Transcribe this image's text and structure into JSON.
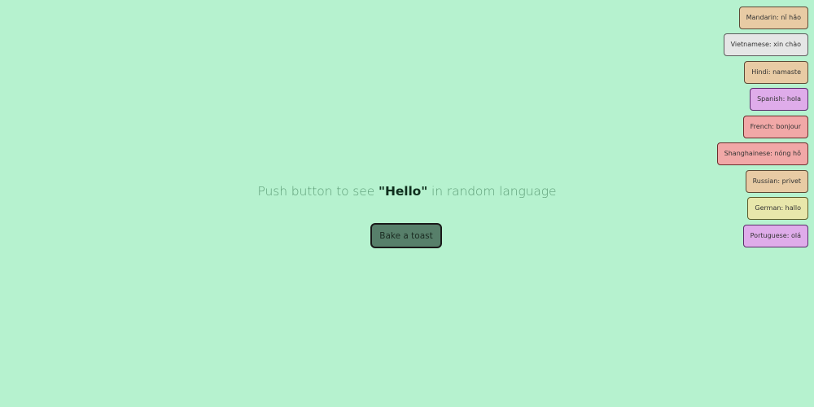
{
  "prompt": {
    "before": "Push button to see ",
    "highlight": "\"Hello\"",
    "after": " in random language"
  },
  "bake_button_label": "Bake a toast",
  "toasts": [
    {
      "text": "Mandarin: nǐ hǎo",
      "bg": "#e8cba4",
      "border": "#5c4a36"
    },
    {
      "text": "Vietnamese: xin chào",
      "bg": "#e5e6e6",
      "border": "#5b5b5b"
    },
    {
      "text": "Hindi: namaste",
      "bg": "#e8cba4",
      "border": "#5c4a36"
    },
    {
      "text": "Spanish: hola",
      "bg": "#dfacea",
      "border": "#5a2a6b"
    },
    {
      "text": "French: bonjour",
      "bg": "#f1a8a7",
      "border": "#6b2c2b"
    },
    {
      "text": "Shanghainese: nóng hǒ",
      "bg": "#f1a8a7",
      "border": "#6b2c2b"
    },
    {
      "text": "Russian: privet",
      "bg": "#e8cba4",
      "border": "#5c4a36"
    },
    {
      "text": "German: hallo",
      "bg": "#e8e7ab",
      "border": "#5e5c2b"
    },
    {
      "text": "Portuguese: olá",
      "bg": "#dfacea",
      "border": "#5a2a6b"
    }
  ]
}
